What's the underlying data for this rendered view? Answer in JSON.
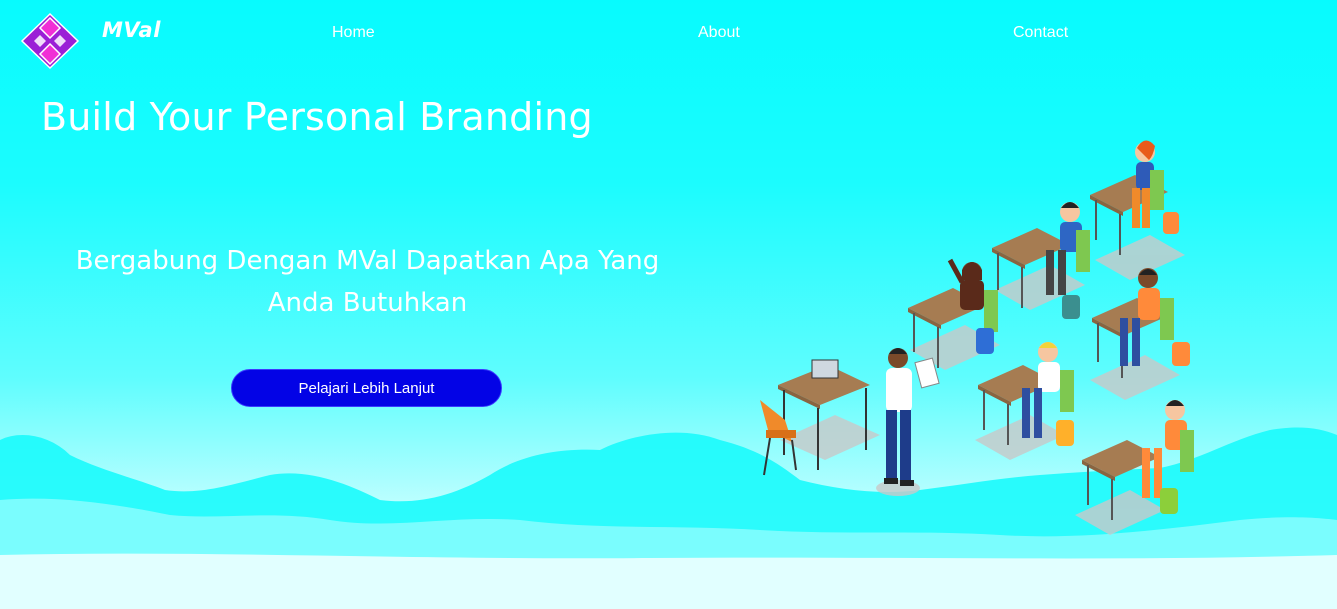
{
  "header": {
    "brand": "MVal",
    "nav": [
      {
        "label": "Home"
      },
      {
        "label": "About"
      },
      {
        "label": "Contact"
      }
    ]
  },
  "hero": {
    "title": "Build Your Personal Branding",
    "subtitle": "Bergabung Dengan MVal Dapatkan Apa Yang Anda Butuhkan",
    "cta_label": "Pelajari Lebih Lanjut"
  },
  "colors": {
    "background_top": "#07fbfe",
    "background_bottom": "#f7ffff",
    "cta": "#0303e6",
    "logo": "#9b1fd6",
    "logo_accent": "#f12fd6"
  },
  "icons": {
    "logo": "mval-diamond-logo"
  }
}
